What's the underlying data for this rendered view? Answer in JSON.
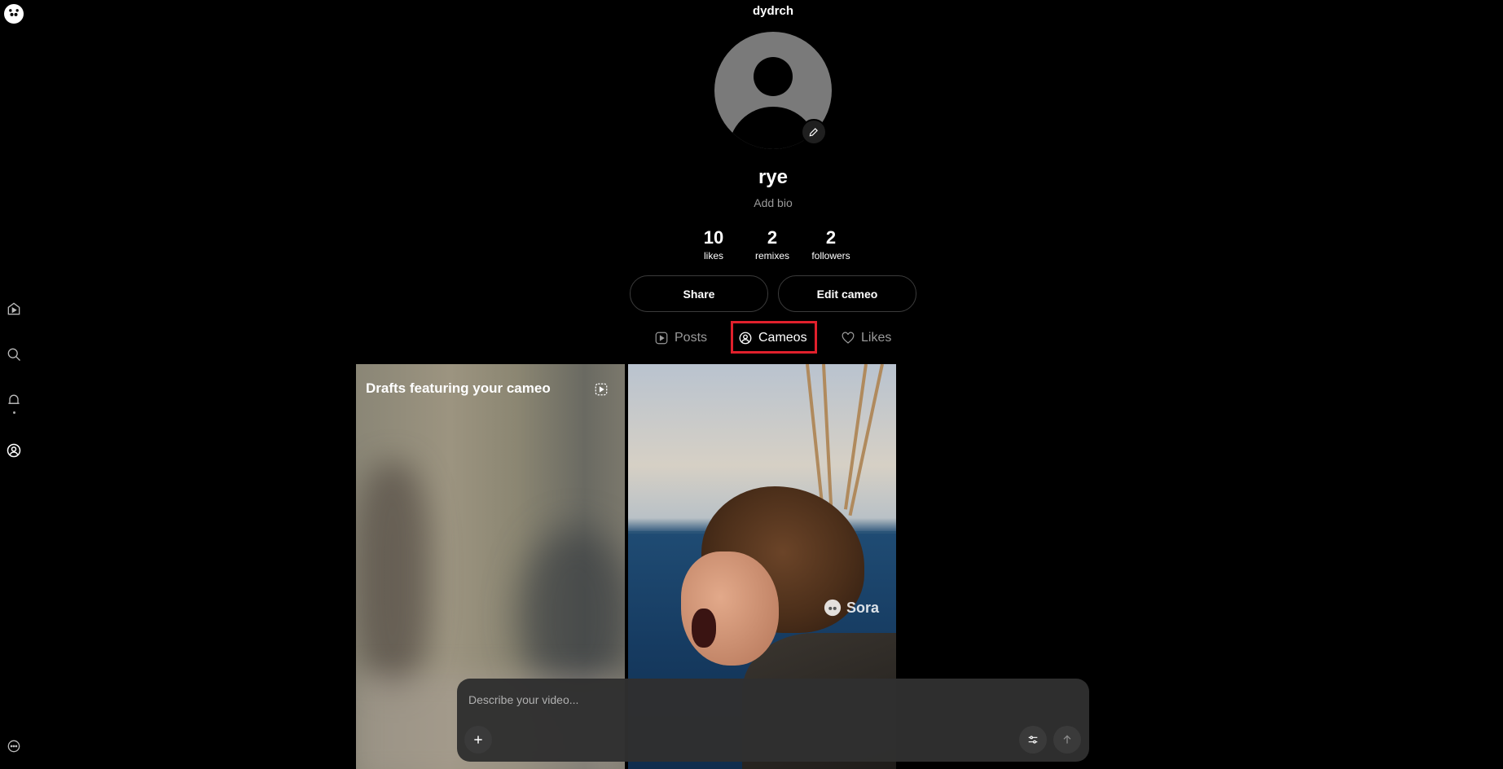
{
  "header": {
    "username": "dydrch"
  },
  "profile": {
    "display_name": "rye",
    "bio_placeholder": "Add bio",
    "stats": [
      {
        "value": "10",
        "label": "likes"
      },
      {
        "value": "2",
        "label": "remixes"
      },
      {
        "value": "2",
        "label": "followers"
      }
    ]
  },
  "actions": {
    "share_label": "Share",
    "edit_label": "Edit cameo"
  },
  "tabs": [
    {
      "label": "Posts",
      "icon": "play-square-icon",
      "active": false
    },
    {
      "label": "Cameos",
      "icon": "user-circle-icon",
      "active": true
    },
    {
      "label": "Likes",
      "icon": "heart-icon",
      "active": false
    }
  ],
  "grid": {
    "drafts_title": "Drafts featuring your cameo",
    "watermark": "Sora"
  },
  "prompt": {
    "placeholder": "Describe your video..."
  },
  "sidebar": {
    "items": [
      {
        "icon": "home-play-icon"
      },
      {
        "icon": "search-icon"
      },
      {
        "icon": "bell-icon"
      },
      {
        "icon": "profile-icon"
      },
      {
        "icon": "more-icon"
      }
    ]
  },
  "colors": {
    "highlight": "#e0202c",
    "background": "#000000",
    "prompt_bg": "#303030"
  }
}
